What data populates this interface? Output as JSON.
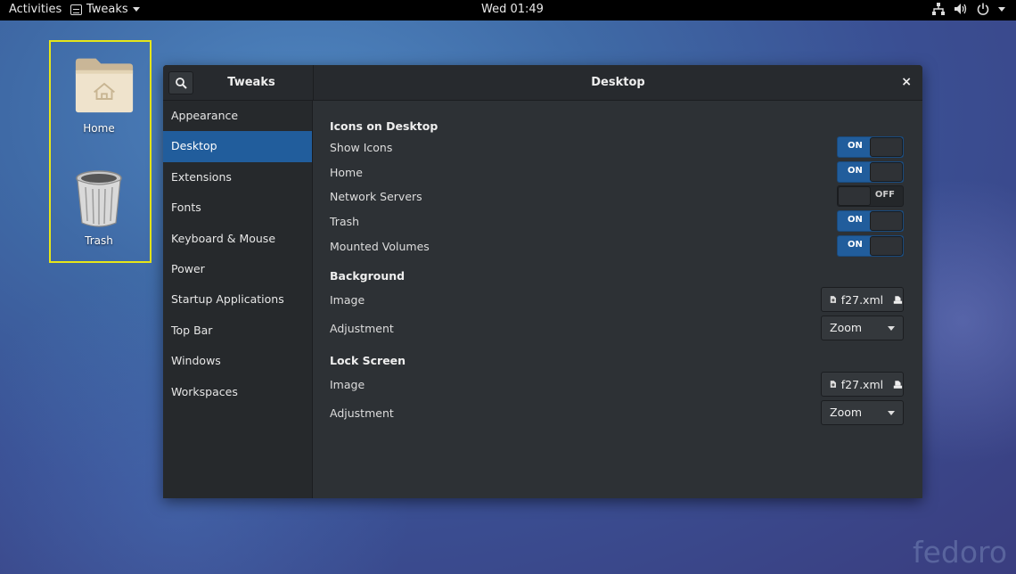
{
  "topbar": {
    "activities": "Activities",
    "app_name": "Tweaks",
    "clock": "Wed 01:49",
    "icons": [
      "network-icon",
      "volume-icon",
      "power-icon",
      "chevron-down-icon"
    ]
  },
  "desktop": {
    "items": [
      {
        "label": "Home",
        "icon": "home-folder-icon"
      },
      {
        "label": "Trash",
        "icon": "trash-icon"
      }
    ],
    "watermark": "fedoro"
  },
  "window": {
    "app_title": "Tweaks",
    "panel_title": "Desktop",
    "close_symbol": "×",
    "sidebar": [
      {
        "label": "Appearance",
        "active": false
      },
      {
        "label": "Desktop",
        "active": true
      },
      {
        "label": "Extensions",
        "active": false
      },
      {
        "label": "Fonts",
        "active": false
      },
      {
        "label": "Keyboard & Mouse",
        "active": false
      },
      {
        "label": "Power",
        "active": false
      },
      {
        "label": "Startup Applications",
        "active": false
      },
      {
        "label": "Top Bar",
        "active": false
      },
      {
        "label": "Windows",
        "active": false
      },
      {
        "label": "Workspaces",
        "active": false
      }
    ],
    "icons_section": {
      "title": "Icons on Desktop",
      "rows": [
        {
          "label": "Show Icons",
          "state": "ON"
        },
        {
          "label": "Home",
          "state": "ON"
        },
        {
          "label": "Network Servers",
          "state": "OFF"
        },
        {
          "label": "Trash",
          "state": "ON"
        },
        {
          "label": "Mounted Volumes",
          "state": "ON"
        }
      ]
    },
    "background_section": {
      "title": "Background",
      "image_label": "Image",
      "image_value": "f27.xml",
      "adjustment_label": "Adjustment",
      "adjustment_value": "Zoom"
    },
    "lock_section": {
      "title": "Lock Screen",
      "image_label": "Image",
      "image_value": "f27.xml",
      "adjustment_label": "Adjustment",
      "adjustment_value": "Zoom"
    }
  },
  "colors": {
    "accent": "#215d9c",
    "selection_outline": "#e6e619"
  }
}
